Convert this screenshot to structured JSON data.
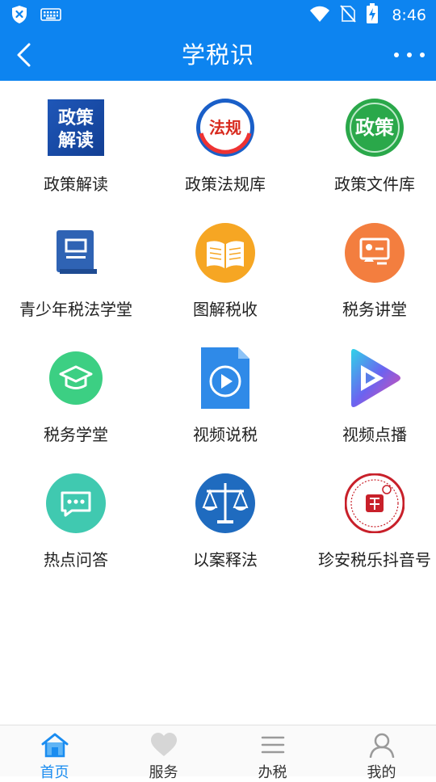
{
  "status_bar": {
    "time": "8:46"
  },
  "header": {
    "title": "学税识"
  },
  "grid": {
    "items": [
      {
        "label": "政策解读",
        "icon_text": [
          "政策",
          "解读"
        ]
      },
      {
        "label": "政策法规库",
        "icon_text": [
          "法规"
        ]
      },
      {
        "label": "政策文件库",
        "icon_text": [
          "政策"
        ]
      },
      {
        "label": "青少年税法学堂"
      },
      {
        "label": "图解税收"
      },
      {
        "label": "税务讲堂"
      },
      {
        "label": "税务学堂"
      },
      {
        "label": "视频说税"
      },
      {
        "label": "视频点播"
      },
      {
        "label": "热点问答"
      },
      {
        "label": "以案释法"
      },
      {
        "label": "珍安税乐抖音号"
      }
    ]
  },
  "bottom_nav": {
    "items": [
      {
        "label": "首页",
        "icon": "home-icon",
        "active": true
      },
      {
        "label": "服务",
        "icon": "heart-icon",
        "active": false
      },
      {
        "label": "办税",
        "icon": "menu-lines-icon",
        "active": false
      },
      {
        "label": "我的",
        "icon": "user-icon",
        "active": false
      }
    ]
  },
  "colors": {
    "primary": "#0d84f0",
    "nav_active": "#1a8cf0"
  }
}
